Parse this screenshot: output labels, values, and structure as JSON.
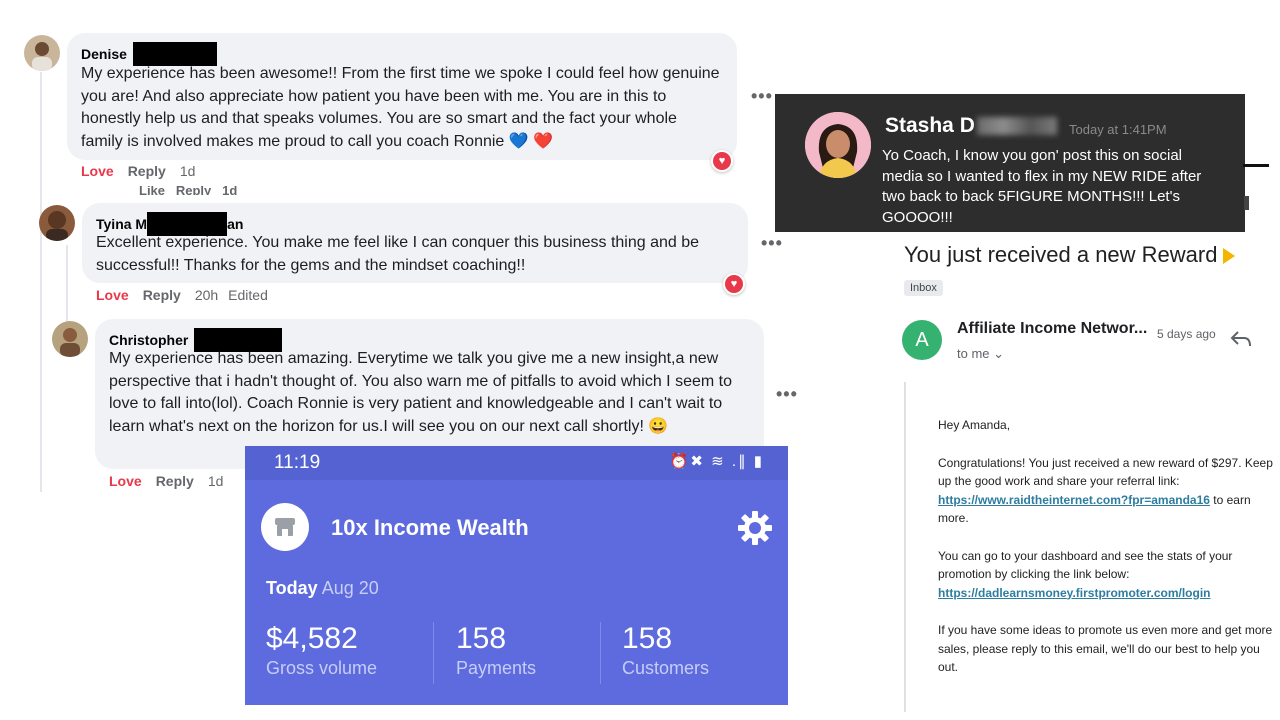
{
  "fb_comments": [
    {
      "author": "Denise",
      "text": "My experience has been awesome!! From the first time we spoke I could feel how genuine you are! And also appreciate how patient you have been with me. You are in this to honestly help us and that speaks volumes. You are so smart and the fact your whole family is involved makes me proud to call you coach Ronnie 💙 ❤️",
      "love_label": "Love",
      "reply_label": "Reply",
      "time": "1d",
      "ghost_text": "Like   Reply   1d"
    },
    {
      "author_prefix": "Tyina M",
      "author_suffix": "an",
      "text": "Excellent experience. You make me feel like I can conquer this business thing and be successful!! Thanks for the gems and the mindset coaching!!",
      "love_label": "Love",
      "reply_label": "Reply",
      "time": "20h",
      "edited": "Edited"
    },
    {
      "author": "Christopher",
      "text": "My experience has been amazing. Everytime we talk you give me a new insight,a new perspective that i hadn't thought of. You also warn me of pitfalls to avoid which I seem to love to fall into(lol). Coach Ronnie is very patient and knowledgeable and I can't wait to learn what's next on the horizon for us.I will see you on our next call shortly! 😀",
      "love_label": "Love",
      "reply_label": "Reply",
      "time": "1d"
    }
  ],
  "more_label": "•••",
  "notification": {
    "name": "Stasha",
    "name_initial": "D",
    "time": "Today at 1:41PM",
    "message": "Yo Coach, I know you gon' post this on social media so I wanted to flex in my NEW RIDE after two back to back 5FIGURE MONTHS!!! Let's GOOOO!!!"
  },
  "email": {
    "subject": "You just received a new Reward",
    "label": "Inbox",
    "sender_initial": "A",
    "sender_name": "Affiliate Income Networ...",
    "sent_time": "5 days ago",
    "to": "to me ⌄",
    "greeting": "Hey Amanda,",
    "para1": "Congratulations! You just received a new reward of $297. Keep up the good work and share your referral link:",
    "link1": "https://www.raidtheinternet.com?fpr=amanda16",
    "para1_end": "to earn more.",
    "para2": "You can go to your dashboard and see the stats of your promotion by clicking the link below:",
    "link2": "https://dadlearnsmoney.firstpromoter.com/login",
    "para3": "If you have some ideas to promote us even more and get more sales, please reply to this email, we'll do our best to help you out."
  },
  "phone": {
    "status_time": "11:19",
    "status_icons": "⏰✖ ≋ .∥ ▮",
    "account_name": "10x Income Wealth",
    "today_label": "Today",
    "date": "Aug 20",
    "stats": [
      {
        "value": "$4,582",
        "label": "Gross volume"
      },
      {
        "value": "158",
        "label": "Payments"
      },
      {
        "value": "158",
        "label": "Customers"
      }
    ]
  },
  "colors": {
    "love_red": "#e8394b",
    "stripe_purple": "#5d6bde",
    "notif_bg": "#2d2d2d",
    "gmail_green_avatar": "#35b26f"
  }
}
